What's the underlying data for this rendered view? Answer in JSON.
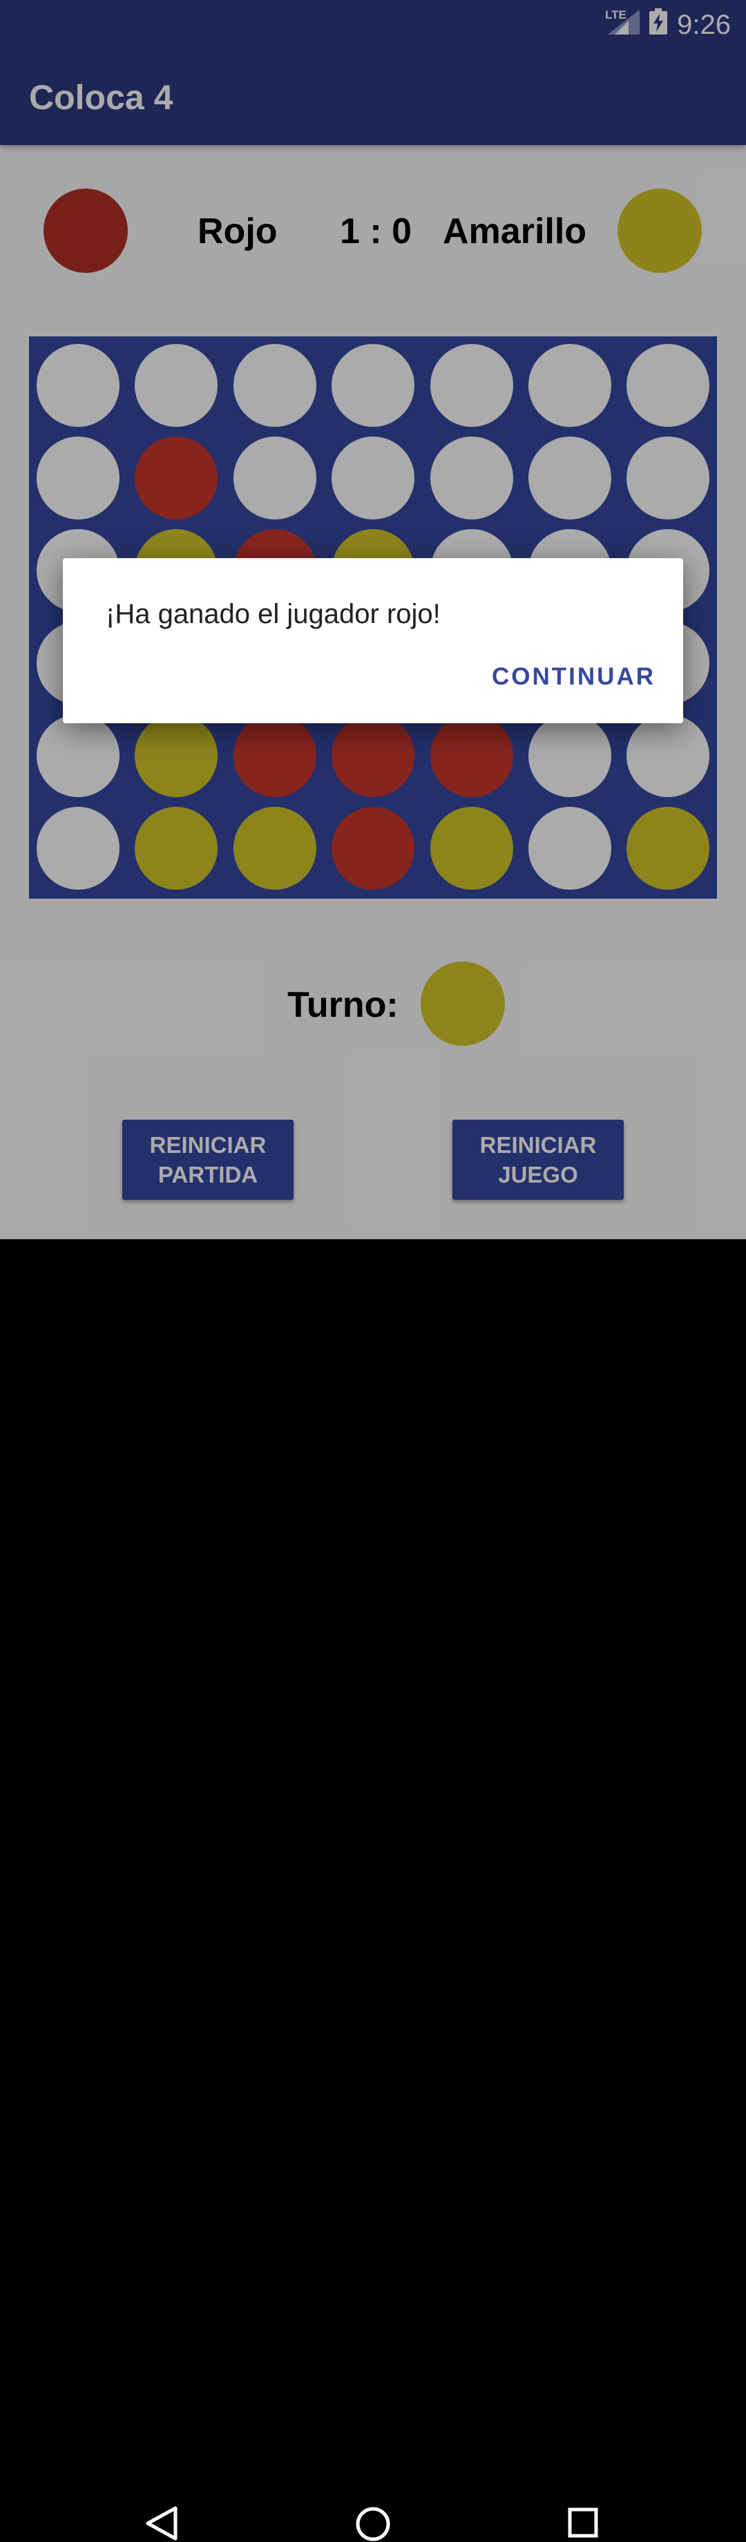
{
  "status_bar": {
    "network": "LTE",
    "time": "9:26"
  },
  "app_bar": {
    "title": "Coloca 4"
  },
  "scoreboard": {
    "player1": {
      "name": "Rojo",
      "color": "#b13026"
    },
    "score": "1 : 0",
    "player2": {
      "name": "Amarillo",
      "color": "#d4c428"
    }
  },
  "board": {
    "rows": 6,
    "cols": 7,
    "empty_color": "#ffffff",
    "red_color": "#c8362c",
    "yellow_color": "#d3c72a",
    "cells": [
      [
        "E",
        "E",
        "E",
        "E",
        "E",
        "E",
        "E"
      ],
      [
        "E",
        "R",
        "E",
        "E",
        "E",
        "E",
        "E"
      ],
      [
        "E",
        "Y",
        "R",
        "Y",
        "E",
        "E",
        "E"
      ],
      [
        "E",
        "Y",
        "Y",
        "R",
        "E",
        "E",
        "E"
      ],
      [
        "E",
        "Y",
        "R",
        "R",
        "R",
        "E",
        "E"
      ],
      [
        "E",
        "Y",
        "Y",
        "R",
        "Y",
        "E",
        "Y"
      ]
    ]
  },
  "turn": {
    "label": "Turno:",
    "color": "#d3c72a"
  },
  "buttons": {
    "reset_match": [
      "REINICIAR",
      "PARTIDA"
    ],
    "reset_game": [
      "REINICIAR",
      "JUEGO"
    ]
  },
  "dialog": {
    "message": "¡Ha ganado el jugador rojo!",
    "action": "CONTINUAR"
  },
  "nav_bar": {
    "icons": [
      "back-icon",
      "home-icon",
      "recents-icon"
    ]
  }
}
